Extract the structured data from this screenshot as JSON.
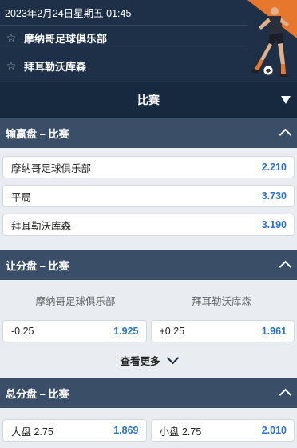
{
  "header": {
    "datetime": "2023年2月24日星期五 01:45",
    "home_team": "摩纳哥足球俱乐部",
    "away_team": "拜耳勒沃库森"
  },
  "match_bar": {
    "label": "比赛"
  },
  "moneyline": {
    "title": "输赢盘 – 比赛",
    "rows": [
      {
        "label": "摩纳哥足球俱乐部",
        "odds": "2.210"
      },
      {
        "label": "平局",
        "odds": "3.730"
      },
      {
        "label": "拜耳勒沃库森",
        "odds": "3.190"
      }
    ]
  },
  "handicap": {
    "title": "让分盘 – 比赛",
    "col_home": "摩纳哥足球俱乐部",
    "col_away": "拜耳勒沃库森",
    "home": {
      "line": "-0.25",
      "odds": "1.925"
    },
    "away": {
      "line": "+0.25",
      "odds": "1.961"
    },
    "see_more": "查看更多"
  },
  "totals": {
    "title": "总分盘 – 比赛",
    "over": {
      "label": "大盘 2.75",
      "odds": "1.869"
    },
    "under": {
      "label": "小盘 2.75",
      "odds": "2.010"
    }
  },
  "colors": {
    "header_bg": "#1d3047",
    "section_bg": "#3a4f67",
    "odds_blue": "#2a72c9",
    "promo_orange": "#e8772e"
  }
}
